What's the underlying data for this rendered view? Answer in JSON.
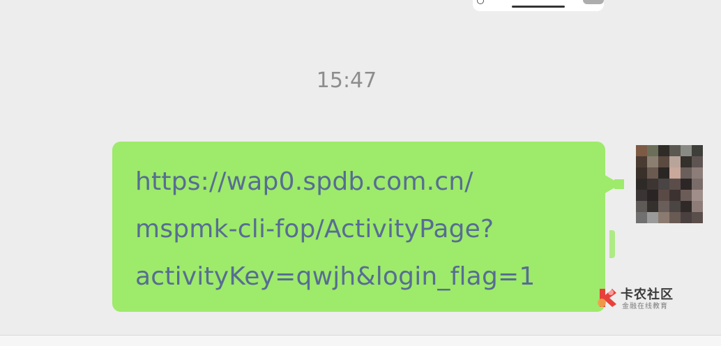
{
  "chat": {
    "timestamp": "15:47",
    "message": {
      "lines": [
        "https://wap0.spdb.com.cn/",
        "mspmk-cli-fop/ActivityPage?",
        "activityKey=qwjh&login_flag=1"
      ]
    }
  },
  "watermark": {
    "title": "卡农社区",
    "subtitle": "金融在线教育"
  },
  "colors": {
    "background": "#ededed",
    "bubble": "#9eea6a",
    "link_text": "#566d93",
    "timestamp": "#8d8d8d"
  },
  "icons": {
    "watermark_logo": "kanong-logo-icon",
    "avatar": "pixelated-avatar"
  }
}
